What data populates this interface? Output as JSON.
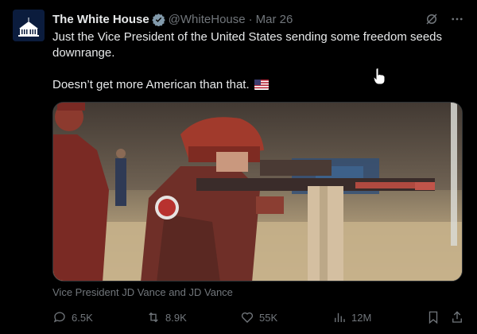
{
  "tweet": {
    "author_name": "The White House",
    "handle": "@WhiteHouse",
    "separator": "·",
    "date": "Mar 26",
    "text_line1": "Just the Vice President of the United States sending some freedom seeds downrange.",
    "text_line2": "Doesn’t get more American than that.",
    "media_caption": "Vice President JD Vance and JD Vance"
  },
  "actions": {
    "replies": "6.5K",
    "reposts": "8.9K",
    "likes": "55K",
    "views": "12M"
  },
  "icons": {
    "verified": "verified-badge-icon",
    "grok": "grok-icon",
    "more": "more-icon",
    "flag": "us-flag-icon",
    "reply": "reply-icon",
    "repost": "repost-icon",
    "like": "like-icon",
    "views": "views-icon",
    "bookmark": "bookmark-icon",
    "share": "share-icon"
  },
  "colors": {
    "background": "#000000",
    "text": "#e7e9ea",
    "muted": "#71767b",
    "verified": "#829aab"
  }
}
